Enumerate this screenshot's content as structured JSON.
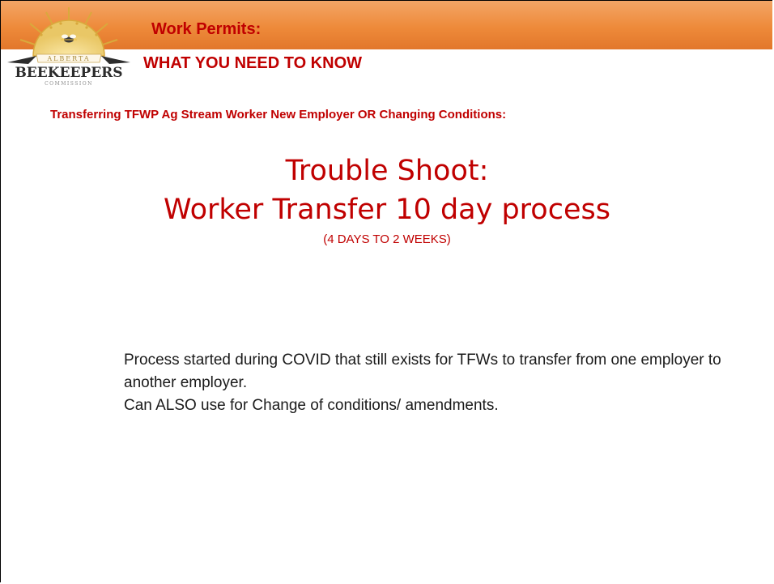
{
  "header": {
    "title_line1": "Work Permits:",
    "title_line2": "WHAT YOU NEED TO KNOW",
    "bar_color": "#ee8a3a",
    "accent_color": "#c00000"
  },
  "logo": {
    "top_text": "ALBERTA",
    "main_text": "BEEKEEPERS",
    "bottom_text": "COMMISSION"
  },
  "subtitle": "Transferring TFWP Ag Stream Worker New Employer OR Changing Conditions:",
  "heading": {
    "line1": "Trouble Shoot:",
    "line2": "Worker Transfer 10 day process",
    "note": "(4 DAYS TO 2 WEEKS)"
  },
  "body": {
    "paragraph1": "Process started during COVID that still exists for TFWs to transfer from one employer to another employer.",
    "paragraph2": "Can ALSO use for Change of conditions/ amendments."
  }
}
